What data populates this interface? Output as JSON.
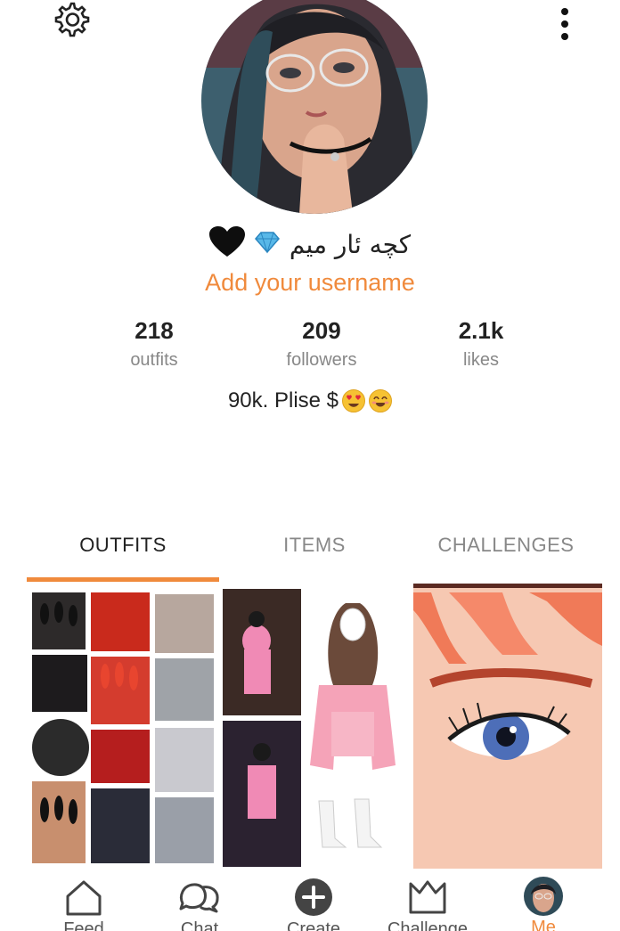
{
  "profile": {
    "display_name": "کچه ئار میم",
    "username_prompt": "Add your username",
    "bio_text": "90k. Plise $",
    "bio_emojis": [
      "heart-eyes-emoji",
      "smiling-emoji"
    ],
    "name_badges": [
      "diamond-icon",
      "black-heart-icon"
    ]
  },
  "stats": [
    {
      "value": "218",
      "label": "outfits"
    },
    {
      "value": "209",
      "label": "followers"
    },
    {
      "value": "2.1k",
      "label": "likes"
    }
  ],
  "tabs": [
    {
      "label": "OUTFITS",
      "active": true
    },
    {
      "label": "ITEMS",
      "active": false
    },
    {
      "label": "CHALLENGES",
      "active": false
    }
  ],
  "nav": [
    {
      "label": "Feed",
      "icon": "home-icon"
    },
    {
      "label": "Chat",
      "icon": "chat-icon"
    },
    {
      "label": "Create",
      "icon": "plus-circle-icon"
    },
    {
      "label": "Challenge",
      "icon": "crown-icon"
    },
    {
      "label": "Me",
      "icon": "avatar",
      "active": true
    }
  ],
  "colors": {
    "accent": "#f08a3c",
    "text": "#222222",
    "muted": "#888888"
  }
}
